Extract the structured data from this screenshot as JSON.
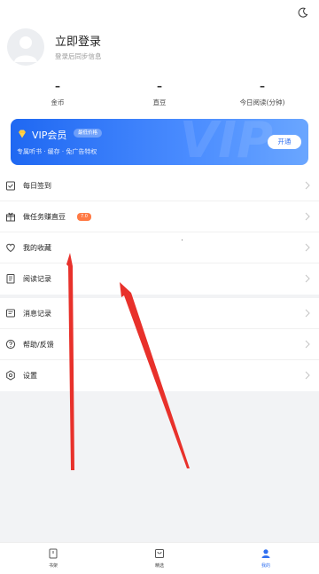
{
  "status_bar": {
    "theme_icon": "moon-icon"
  },
  "profile": {
    "login_title": "立即登录",
    "login_subtitle": "登录后同步信息",
    "stats": [
      {
        "value": "–",
        "label": "金币"
      },
      {
        "value": "–",
        "label": "直豆"
      },
      {
        "value": "–",
        "label": "今日阅读(分钟)"
      }
    ]
  },
  "vip": {
    "title": "VIP会员",
    "badge": "最低价格",
    "desc": "专属听书 · 缓存 · 免广告特权",
    "button": "开通",
    "watermark": "VIP"
  },
  "menu": {
    "group1": [
      {
        "label": "每日签到",
        "icon": "calendar-check-icon"
      },
      {
        "label": "做任务赚直豆",
        "icon": "gift-icon",
        "pill": "7.0"
      },
      {
        "label": "我的收藏",
        "icon": "heart-icon"
      },
      {
        "label": "阅读记录",
        "icon": "book-icon"
      }
    ],
    "group2": [
      {
        "label": "消息记录",
        "icon": "message-icon"
      },
      {
        "label": "帮助/反馈",
        "icon": "help-icon"
      },
      {
        "label": "设置",
        "icon": "settings-icon"
      }
    ]
  },
  "bottom_nav": [
    {
      "label": "书架",
      "icon": "bookshelf-icon"
    },
    {
      "label": "精选",
      "icon": "featured-icon"
    },
    {
      "label": "我的",
      "icon": "profile-icon",
      "active": true
    }
  ],
  "colors": {
    "accent": "#2f6ff0",
    "pill": "#ff7a45",
    "annotation_arrow": "#e8312b"
  }
}
